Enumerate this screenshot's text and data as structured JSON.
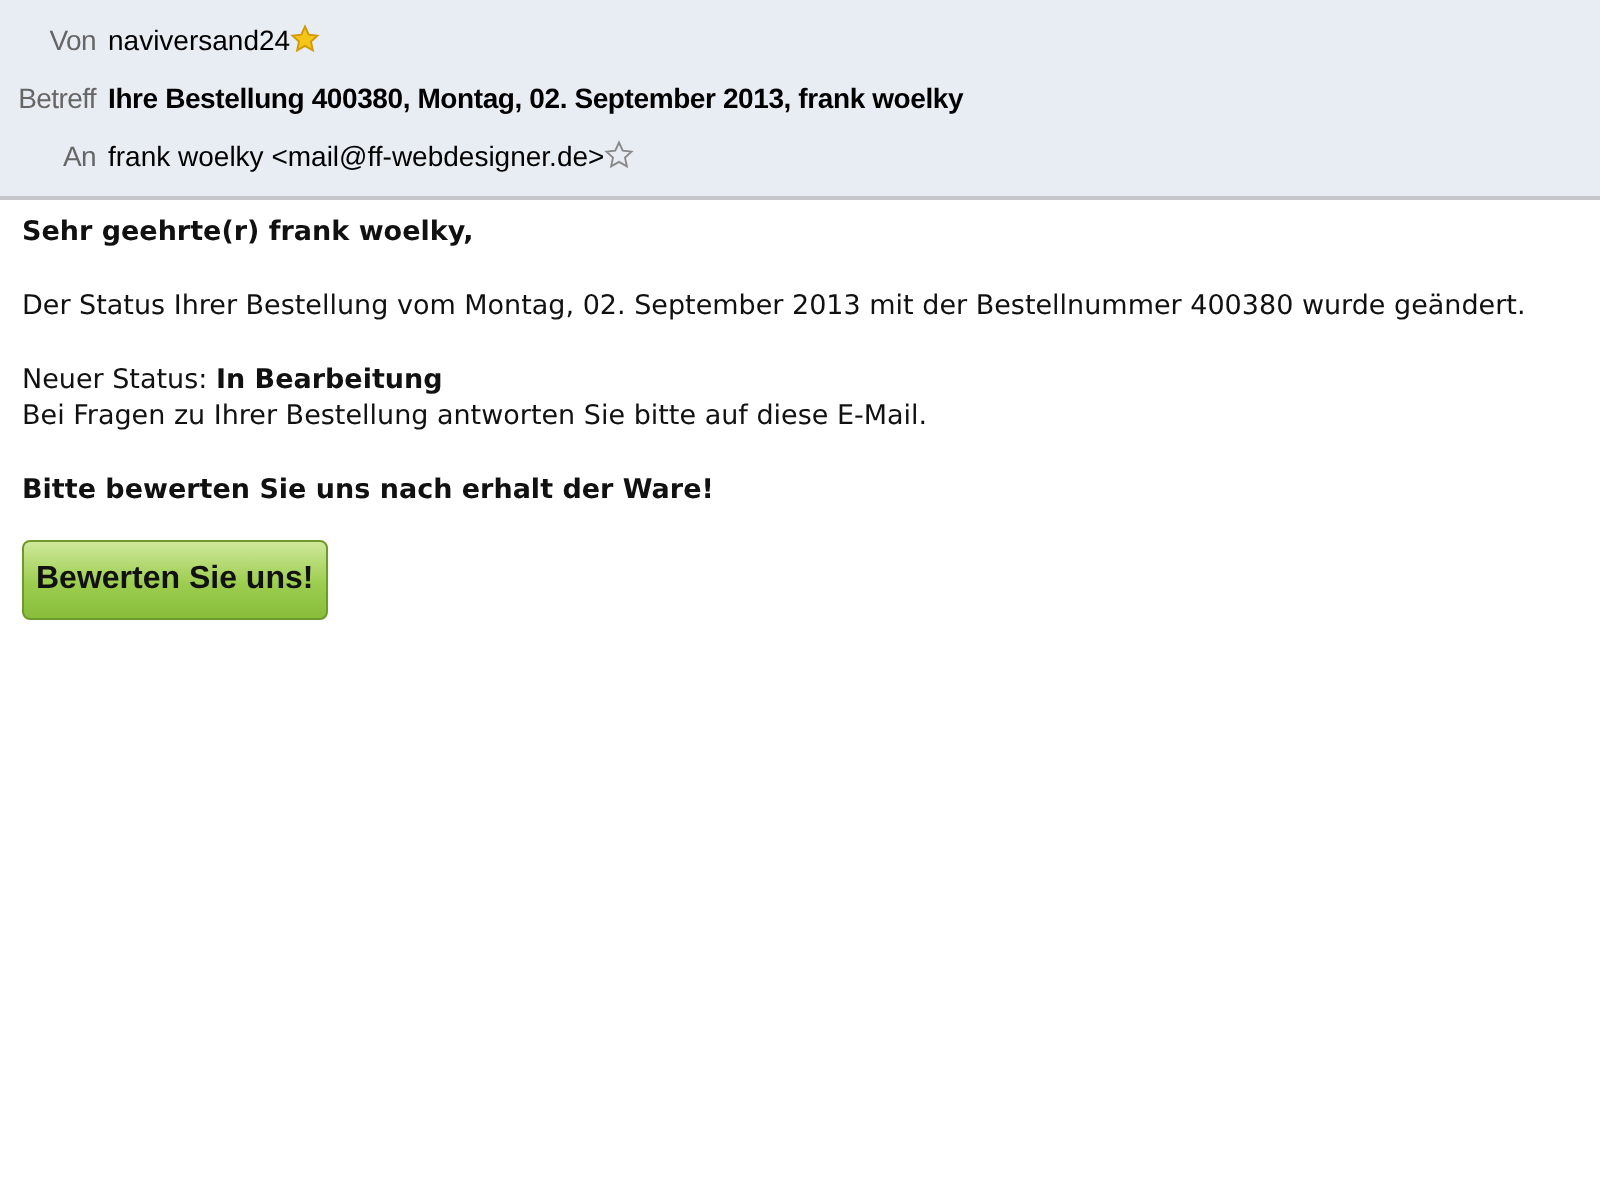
{
  "header": {
    "fields": [
      {
        "kind": "contact",
        "label": "Von",
        "value": "naviversand24",
        "starred": true
      },
      {
        "kind": "subject",
        "label": "Betreff",
        "value": "Ihre Bestellung 400380, Montag, 02. September 2013, frank woelky"
      },
      {
        "kind": "contact",
        "label": "An",
        "value": "frank woelky <mail@ff-webdesigner.de>",
        "starred": false
      }
    ]
  },
  "body": {
    "blocks": [
      {
        "kind": "heading",
        "lines": [
          "Sehr geehrte(r) frank woelky,"
        ]
      },
      {
        "kind": "text",
        "lines": [
          "Der Status Ihrer Bestellung vom Montag, 02. September 2013 mit der Bestellnummer 400380 wurde geändert."
        ]
      },
      {
        "kind": "text",
        "lines": [
          "Neuer Status: **In Bearbeitung**",
          "Bei Fragen zu Ihrer Bestellung antworten Sie bitte auf diese E-Mail."
        ]
      },
      {
        "kind": "heading",
        "lines": [
          "Bitte bewerten Sie uns nach erhalt der Ware!"
        ]
      }
    ],
    "button": {
      "label": "Bewerten Sie uns!"
    }
  }
}
